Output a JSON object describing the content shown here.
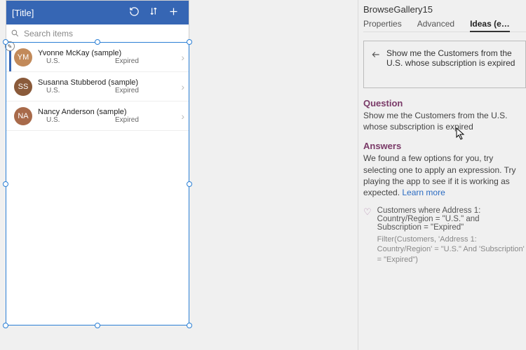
{
  "phone": {
    "title": "[Title]",
    "search_placeholder": "Search items",
    "rows": [
      {
        "name": "Yvonne McKay (sample)",
        "loc": "U.S.",
        "status": "Expired",
        "color": "#c28a5a",
        "initials": "YM",
        "selected": true
      },
      {
        "name": "Susanna Stubberod (sample)",
        "loc": "U.S.",
        "status": "Expired",
        "color": "#8a5a3a",
        "initials": "SS",
        "selected": false
      },
      {
        "name": "Nancy Anderson (sample)",
        "loc": "U.S.",
        "status": "Expired",
        "color": "#a86a4a",
        "initials": "NA",
        "selected": false
      }
    ]
  },
  "panel": {
    "control_name": "BrowseGallery15",
    "tabs": {
      "properties": "Properties",
      "advanced": "Advanced",
      "ideas": "Ideas (e…"
    },
    "question_text": "Show me the Customers from the U.S. whose subscription is expired",
    "question_head": "Question",
    "question_echo": "Show me the Customers from the U.S. whose subscription is expired",
    "answers_head": "Answers",
    "answers_body_a": "We found a few options for you, try selecting one to apply an expression. Try playing the app to see if it is working as expected. ",
    "answers_learn": "Learn more",
    "answer1_title": "Customers where Address 1: Country/Region = \"U.S.\" and Subscription = \"Expired\"",
    "answer1_fx": "Filter(Customers, 'Address 1: Country/Region' = \"U.S.\" And 'Subscription' = \"Expired\")"
  }
}
